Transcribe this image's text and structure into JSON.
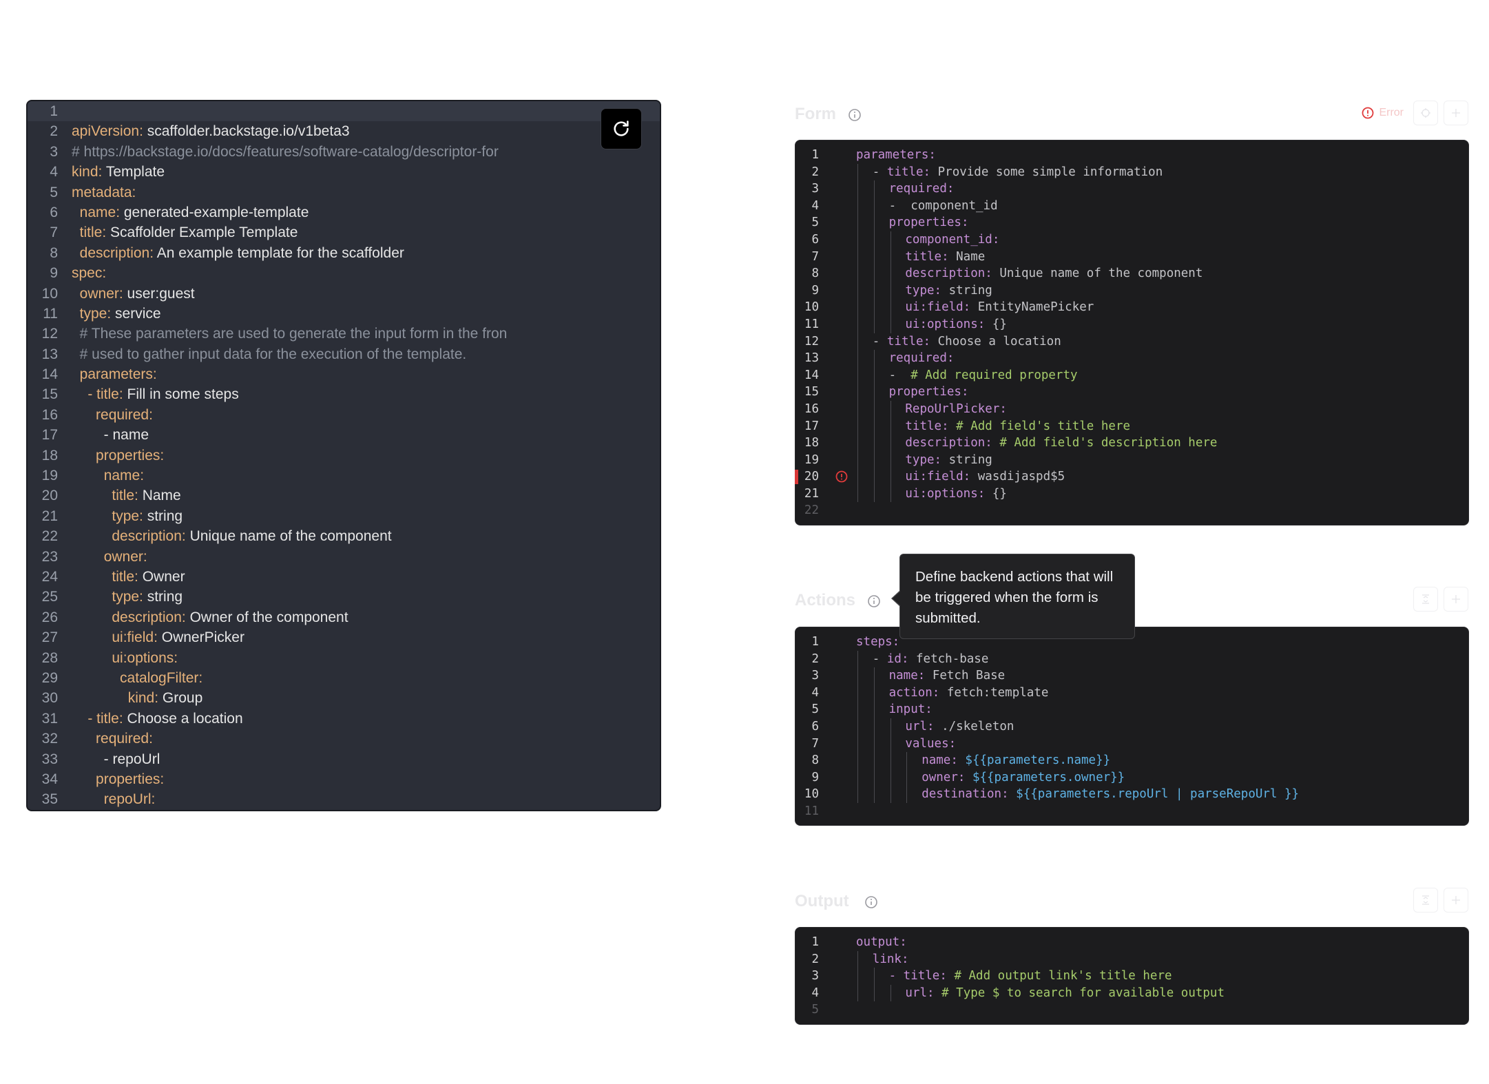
{
  "left_editor": {
    "lines": [
      [],
      [
        [
          "key",
          "apiVersion:"
        ],
        [
          "val",
          " scaffolder.backstage.io/v1beta3"
        ]
      ],
      [
        [
          "comment",
          "# https://backstage.io/docs/features/software-catalog/descriptor-for"
        ]
      ],
      [
        [
          "key",
          "kind:"
        ],
        [
          "val",
          " Template"
        ]
      ],
      [
        [
          "key",
          "metadata:"
        ]
      ],
      [
        [
          "val",
          "  "
        ],
        [
          "key",
          "name:"
        ],
        [
          "val",
          " generated-example-template"
        ]
      ],
      [
        [
          "val",
          "  "
        ],
        [
          "key",
          "title:"
        ],
        [
          "val",
          " Scaffolder Example Template"
        ]
      ],
      [
        [
          "val",
          "  "
        ],
        [
          "key",
          "description:"
        ],
        [
          "val",
          " An example template for the scaffolder"
        ]
      ],
      [
        [
          "key",
          "spec:"
        ]
      ],
      [
        [
          "val",
          "  "
        ],
        [
          "key",
          "owner:"
        ],
        [
          "val",
          " user:guest"
        ]
      ],
      [
        [
          "val",
          "  "
        ],
        [
          "key",
          "type:"
        ],
        [
          "val",
          " service"
        ]
      ],
      [
        [
          "val",
          "  "
        ],
        [
          "comment",
          "# These parameters are used to generate the input form in the fron"
        ]
      ],
      [
        [
          "val",
          "  "
        ],
        [
          "comment",
          "# used to gather input data for the execution of the template."
        ]
      ],
      [
        [
          "val",
          "  "
        ],
        [
          "key",
          "parameters:"
        ]
      ],
      [
        [
          "val",
          "    "
        ],
        [
          "key",
          "- title:"
        ],
        [
          "val",
          " Fill in some steps"
        ]
      ],
      [
        [
          "val",
          "      "
        ],
        [
          "key",
          "required:"
        ]
      ],
      [
        [
          "val",
          "        - name"
        ]
      ],
      [
        [
          "val",
          "      "
        ],
        [
          "key",
          "properties:"
        ]
      ],
      [
        [
          "val",
          "        "
        ],
        [
          "key",
          "name:"
        ]
      ],
      [
        [
          "val",
          "          "
        ],
        [
          "key",
          "title:"
        ],
        [
          "val",
          " Name"
        ]
      ],
      [
        [
          "val",
          "          "
        ],
        [
          "key",
          "type:"
        ],
        [
          "val",
          " string"
        ]
      ],
      [
        [
          "val",
          "          "
        ],
        [
          "key",
          "description:"
        ],
        [
          "val",
          " Unique name of the component"
        ]
      ],
      [
        [
          "val",
          "        "
        ],
        [
          "key",
          "owner:"
        ]
      ],
      [
        [
          "val",
          "          "
        ],
        [
          "key",
          "title:"
        ],
        [
          "val",
          " Owner"
        ]
      ],
      [
        [
          "val",
          "          "
        ],
        [
          "key",
          "type:"
        ],
        [
          "val",
          " string"
        ]
      ],
      [
        [
          "val",
          "          "
        ],
        [
          "key",
          "description:"
        ],
        [
          "val",
          " Owner of the component"
        ]
      ],
      [
        [
          "val",
          "          "
        ],
        [
          "key",
          "ui:field:"
        ],
        [
          "val",
          " OwnerPicker"
        ]
      ],
      [
        [
          "val",
          "          "
        ],
        [
          "key",
          "ui:options:"
        ]
      ],
      [
        [
          "val",
          "            "
        ],
        [
          "key",
          "catalogFilter:"
        ]
      ],
      [
        [
          "val",
          "              "
        ],
        [
          "key",
          "kind:"
        ],
        [
          "val",
          " Group"
        ]
      ],
      [
        [
          "val",
          "    "
        ],
        [
          "key",
          "- title:"
        ],
        [
          "val",
          " Choose a location"
        ]
      ],
      [
        [
          "val",
          "      "
        ],
        [
          "key",
          "required:"
        ]
      ],
      [
        [
          "val",
          "        - repoUrl"
        ]
      ],
      [
        [
          "val",
          "      "
        ],
        [
          "key",
          "properties:"
        ]
      ],
      [
        [
          "val",
          "        "
        ],
        [
          "key",
          "repoUrl:"
        ]
      ]
    ],
    "reload_icon": "refresh-icon"
  },
  "form_panel": {
    "title": "Form",
    "error_label": "Error",
    "lines": [
      {
        "g": 0,
        "c": [
          [
            "key",
            "parameters:"
          ]
        ]
      },
      {
        "g": 1,
        "c": [
          [
            "val",
            "- "
          ],
          [
            "key",
            "title:"
          ],
          [
            "val",
            " Provide some simple information"
          ]
        ]
      },
      {
        "g": 2,
        "c": [
          [
            "key",
            "required:"
          ]
        ]
      },
      {
        "g": 2,
        "c": [
          [
            "val",
            "-  component_id"
          ]
        ]
      },
      {
        "g": 2,
        "c": [
          [
            "key",
            "properties:"
          ]
        ]
      },
      {
        "g": 3,
        "c": [
          [
            "key",
            "component_id:"
          ]
        ]
      },
      {
        "g": 3,
        "c": [
          [
            "key",
            "title:"
          ],
          [
            "val",
            " Name"
          ]
        ]
      },
      {
        "g": 3,
        "c": [
          [
            "key",
            "description:"
          ],
          [
            "val",
            " Unique name of the component"
          ]
        ]
      },
      {
        "g": 3,
        "c": [
          [
            "key",
            "type:"
          ],
          [
            "val",
            " string"
          ]
        ]
      },
      {
        "g": 3,
        "c": [
          [
            "key",
            "ui:field:"
          ],
          [
            "val",
            " EntityNamePicker"
          ]
        ]
      },
      {
        "g": 3,
        "c": [
          [
            "key",
            "ui:options:"
          ],
          [
            "val",
            " {}"
          ]
        ]
      },
      {
        "g": 1,
        "c": [
          [
            "val",
            "- "
          ],
          [
            "key",
            "title:"
          ],
          [
            "val",
            " Choose a location"
          ]
        ]
      },
      {
        "g": 2,
        "c": [
          [
            "key",
            "required:"
          ]
        ]
      },
      {
        "g": 2,
        "c": [
          [
            "val",
            "-  "
          ],
          [
            "comment",
            "# Add required property"
          ]
        ]
      },
      {
        "g": 2,
        "c": [
          [
            "key",
            "properties:"
          ]
        ]
      },
      {
        "g": 3,
        "c": [
          [
            "key",
            "RepoUrlPicker:"
          ]
        ]
      },
      {
        "g": 3,
        "c": [
          [
            "key",
            "title:"
          ],
          [
            "val",
            " "
          ],
          [
            "comment",
            "# Add field's title here"
          ]
        ]
      },
      {
        "g": 3,
        "c": [
          [
            "key",
            "description:"
          ],
          [
            "val",
            " "
          ],
          [
            "comment",
            "# Add field's description here"
          ]
        ]
      },
      {
        "g": 3,
        "c": [
          [
            "key",
            "type:"
          ],
          [
            "val",
            " string"
          ]
        ]
      },
      {
        "g": 3,
        "c": [
          [
            "key",
            "ui:field:"
          ],
          [
            "val",
            " wasdijaspd$5"
          ]
        ],
        "error": true
      },
      {
        "g": 3,
        "c": [
          [
            "key",
            "ui:options:"
          ],
          [
            "val",
            " {}"
          ]
        ]
      },
      {
        "g": 0,
        "c": []
      }
    ]
  },
  "actions_panel": {
    "title": "Actions",
    "lines": [
      {
        "g": 0,
        "c": [
          [
            "key",
            "steps:"
          ]
        ]
      },
      {
        "g": 1,
        "c": [
          [
            "val",
            "- "
          ],
          [
            "key",
            "id:"
          ],
          [
            "val",
            " fetch-base"
          ]
        ]
      },
      {
        "g": 2,
        "c": [
          [
            "key",
            "name:"
          ],
          [
            "val",
            " Fetch Base"
          ]
        ]
      },
      {
        "g": 2,
        "c": [
          [
            "key",
            "action:"
          ],
          [
            "val",
            " fetch:template"
          ]
        ]
      },
      {
        "g": 2,
        "c": [
          [
            "key",
            "input:"
          ]
        ]
      },
      {
        "g": 3,
        "c": [
          [
            "key",
            "url:"
          ],
          [
            "val",
            " ./skeleton"
          ]
        ]
      },
      {
        "g": 3,
        "c": [
          [
            "key",
            "values:"
          ]
        ]
      },
      {
        "g": 4,
        "c": [
          [
            "key",
            "name:"
          ],
          [
            "val",
            " "
          ],
          [
            "tpl",
            "${{parameters.name}}"
          ]
        ]
      },
      {
        "g": 4,
        "c": [
          [
            "key",
            "owner:"
          ],
          [
            "val",
            " "
          ],
          [
            "tpl",
            "${{parameters.owner}}"
          ]
        ]
      },
      {
        "g": 4,
        "c": [
          [
            "key",
            "destination:"
          ],
          [
            "val",
            " "
          ],
          [
            "tpl",
            "${{parameters.repoUrl | parseRepoUrl }}"
          ]
        ]
      },
      {
        "g": 0,
        "c": []
      }
    ]
  },
  "output_panel": {
    "title": "Output",
    "lines": [
      {
        "g": 0,
        "c": [
          [
            "key",
            "output:"
          ]
        ]
      },
      {
        "g": 1,
        "c": [
          [
            "key",
            "link:"
          ]
        ]
      },
      {
        "g": 2,
        "c": [
          [
            "key",
            "- title:"
          ],
          [
            "val",
            " "
          ],
          [
            "comment",
            "# Add output link's title here"
          ]
        ]
      },
      {
        "g": 3,
        "c": [
          [
            "key",
            "url:"
          ],
          [
            "val",
            " "
          ],
          [
            "comment",
            "# Type $ to search for available output"
          ]
        ]
      },
      {
        "g": 0,
        "c": []
      }
    ]
  },
  "tooltip": {
    "text": "Define backend actions that will be triggered when the form is submitted."
  },
  "icons": {
    "info": "info-icon",
    "error": "error-circle-icon",
    "target": "target-icon",
    "collapse": "collapse-icon",
    "plus": "plus-icon"
  }
}
